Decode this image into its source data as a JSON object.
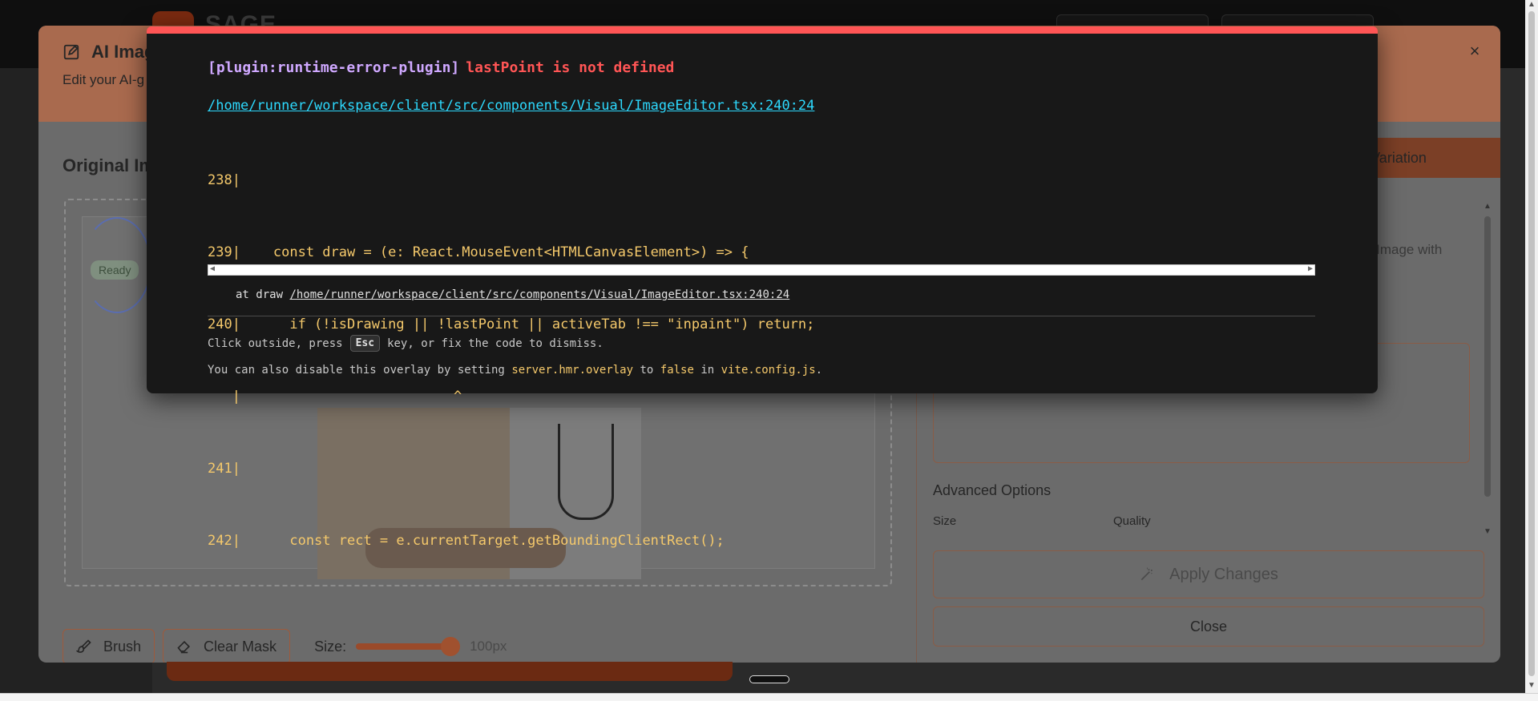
{
  "app": {
    "logo_text": "SAGE"
  },
  "dialog": {
    "title": "AI Imag",
    "subtitle": "Edit your AI-g",
    "close_symbol": "×",
    "left_heading": "Original Im",
    "ready_badge": "Ready",
    "tools": {
      "brush_label": "Brush",
      "clear_mask_label": "Clear Mask",
      "size_label": "Size:",
      "size_value": "100px",
      "size_value_number": 100
    },
    "right": {
      "tab_variation": "Variation",
      "desc_fragment": "PT Image with",
      "advanced_title": "Advanced Options",
      "size_col": "Size",
      "quality_col": "Quality",
      "apply_label": "Apply Changes",
      "close_label": "Close"
    }
  },
  "error_overlay": {
    "plugin": "[plugin:runtime-error-plugin]",
    "message": "lastPoint is not defined",
    "file_link": "/home/runner/workspace/client/src/components/Visual/ImageEditor.tsx:240:24",
    "code_lines": [
      "238|",
      "239|    const draw = (e: React.MouseEvent<HTMLCanvasElement>) => {",
      "240|      if (!isDrawing || !lastPoint || activeTab !== \"inpaint\") return;",
      "   |                          ^",
      "241|",
      "242|      const rect = e.currentTarget.getBoundingClientRect();"
    ],
    "stack_prefix": "at draw",
    "stack_file": "/home/runner/workspace/client/src/components/Visual/ImageEditor.tsx:240:24",
    "tip_part1": "Click outside, press",
    "tip_key": "Esc",
    "tip_part2": "key, or fix the code to dismiss.",
    "tip2_part1": "You can also disable this overlay by setting",
    "tip2_code1": "server.hmr.overlay",
    "tip2_part2": "to",
    "tip2_code2": "false",
    "tip2_part3": "in",
    "tip2_code3": "vite.config.js",
    "tip2_end": "."
  },
  "icons": [
    "edit-icon",
    "close-icon",
    "brush-icon",
    "eraser-icon",
    "wand-icon"
  ],
  "colors": {
    "error_red": "#ff5555",
    "plugin_purple": "#cfa8ff",
    "link_cyan": "#2dd9fe",
    "code_yellow": "#f5c96b",
    "accent_orange": "#e0632a"
  }
}
